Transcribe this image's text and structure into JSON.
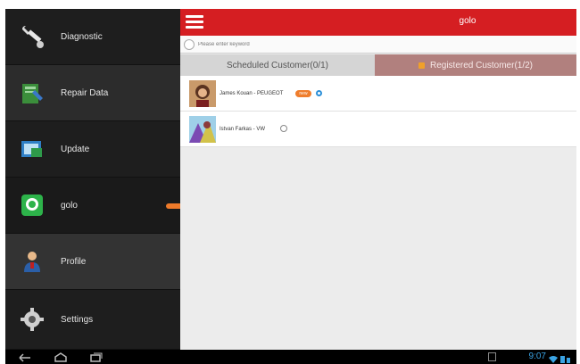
{
  "sidebar": {
    "items": [
      {
        "label": "Diagnostic",
        "icon": "wrench-icon"
      },
      {
        "label": "Repair Data",
        "icon": "repair-data-icon"
      },
      {
        "label": "Update",
        "icon": "update-icon"
      },
      {
        "label": "golo",
        "icon": "golo-chat-icon"
      },
      {
        "label": "Profile",
        "icon": "profile-icon"
      },
      {
        "label": "Settings",
        "icon": "settings-gear-icon"
      }
    ]
  },
  "header": {
    "title": "golo"
  },
  "search": {
    "placeholder": "Please enter keyword"
  },
  "tabs": {
    "scheduled": "Scheduled Customer(0/1)",
    "registered": "Registered Customer(1/2)"
  },
  "customers": [
    {
      "name": "James Kouan - PEUGEOT",
      "badge": "new"
    },
    {
      "name": "Istvan Farkas - VW"
    }
  ],
  "statusbar": {
    "time": "9:07"
  },
  "colors": {
    "brand_red": "#d51e22",
    "registered_tab": "#b1807e",
    "accent_orange": "#ee7a2a",
    "clock_blue": "#3aa3e3"
  }
}
